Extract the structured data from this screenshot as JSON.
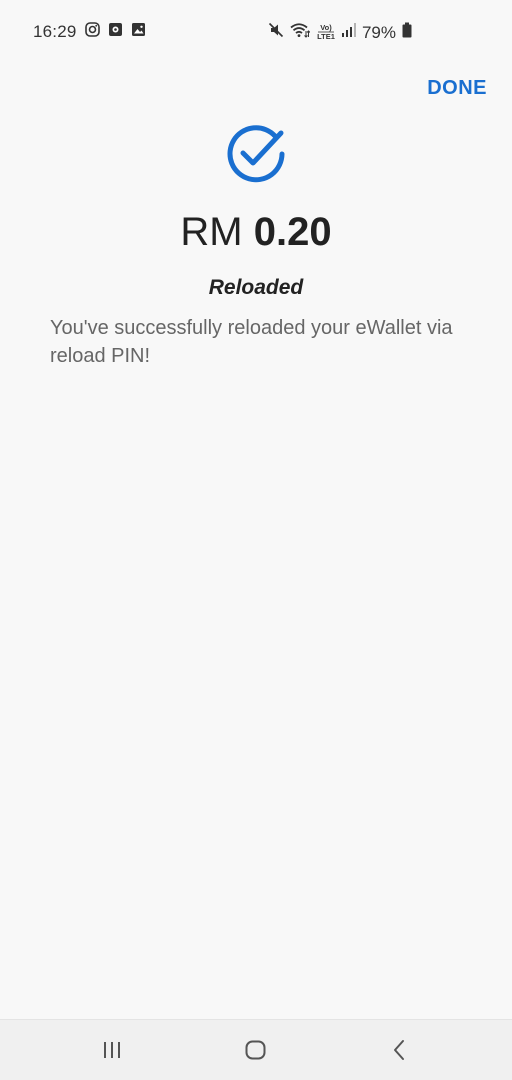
{
  "status_bar": {
    "time": "16:29",
    "left_icons": [
      "instagram-icon",
      "app-notification-icon",
      "gallery-icon"
    ],
    "right_icons": [
      "mute-icon",
      "wifi-icon",
      "volte-icon",
      "signal-icon",
      "battery-icon"
    ],
    "volte_label": "Vo)\nLTE1",
    "battery": "79%"
  },
  "header": {
    "done_label": "DONE"
  },
  "result": {
    "currency": "RM",
    "amount": "0.20",
    "status": "Reloaded",
    "message": "You've successfully reloaded your eWallet via reload PIN!"
  },
  "colors": {
    "accent": "#1a6fd0",
    "text_primary": "#222222",
    "text_secondary": "#666666",
    "background": "#f8f8f8"
  },
  "nav_bar": {
    "buttons": [
      "recent-apps",
      "home",
      "back"
    ]
  }
}
